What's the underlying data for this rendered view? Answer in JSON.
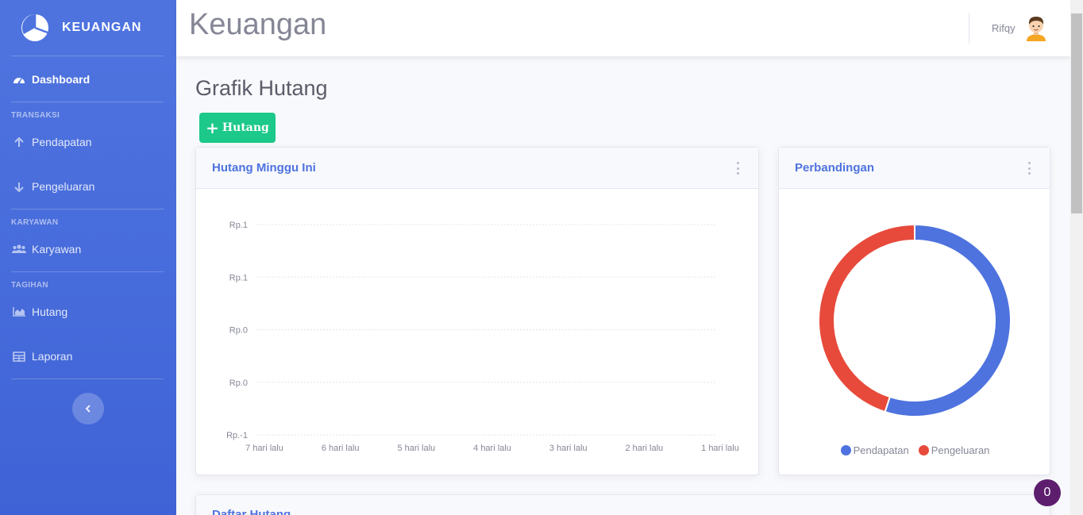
{
  "sidebar": {
    "brand": "KEUANGAN",
    "dashboard": "Dashboard",
    "heading_transaksi": "TRANSAKSI",
    "pendapatan": "Pendapatan",
    "pengeluaran": "Pengeluaran",
    "heading_karyawan": "KARYAWAN",
    "karyawan": "Karyawan",
    "heading_tagihan": "TAGIHAN",
    "hutang": "Hutang",
    "laporan": "Laporan"
  },
  "topbar": {
    "title": "Keuangan",
    "user_name": "Rifqy"
  },
  "page": {
    "heading": "Grafik Hutang",
    "add_button": "Hutang"
  },
  "card_weekly": {
    "title": "Hutang Minggu Ini"
  },
  "card_compare": {
    "title": "Perbandingan"
  },
  "card_list": {
    "title": "Daftar Hutang"
  },
  "notification": {
    "count": "0"
  },
  "colors": {
    "primary": "#4e73df",
    "success": "#1cc88a",
    "danger": "#e74a3b"
  },
  "chart_data": [
    {
      "type": "line",
      "title": "Hutang Minggu Ini",
      "categories": [
        "7 hari lalu",
        "6 hari lalu",
        "5 hari lalu",
        "4 hari lalu",
        "3 hari lalu",
        "2 hari lalu",
        "1 hari lalu"
      ],
      "y_tick_labels": [
        "Rp.1",
        "Rp.1",
        "Rp.0",
        "Rp.0",
        "Rp.-1"
      ],
      "series": [],
      "ylim": [
        -1,
        1
      ],
      "grid": true
    },
    {
      "type": "pie",
      "title": "Perbandingan",
      "labels": [
        "Pendapatan",
        "Pengeluaran"
      ],
      "values": [
        55,
        45
      ],
      "colors": [
        "#4e73df",
        "#e74a3b"
      ],
      "legend": "bottom"
    }
  ]
}
